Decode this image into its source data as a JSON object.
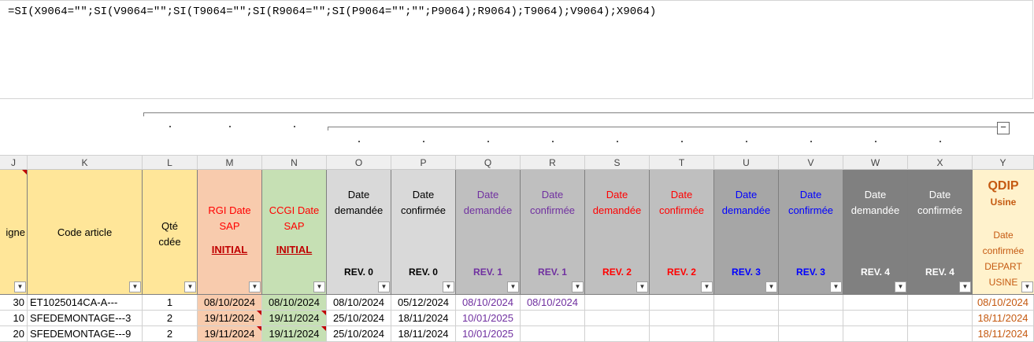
{
  "formula_bar": {
    "text": "=SI(X9064=\"\";SI(V9064=\"\";SI(T9064=\"\";SI(R9064=\"\";SI(P9064=\"\";\"\";P9064);R9064);T9064);V9064);X9064)"
  },
  "outline": {
    "collapse_symbol": "−"
  },
  "columns": [
    "J",
    "K",
    "L",
    "M",
    "N",
    "O",
    "P",
    "Q",
    "R",
    "S",
    "T",
    "U",
    "V",
    "W",
    "X",
    "Y"
  ],
  "headers": {
    "J": {
      "text": "igne"
    },
    "K": {
      "text": "Code article"
    },
    "L": {
      "line1": "Qté",
      "line2": "cdée"
    },
    "M": {
      "line1": "RGI Date",
      "line2": "SAP",
      "tag": "INITIAL"
    },
    "N": {
      "line1": "CCGI Date",
      "line2": "SAP",
      "tag": "INITIAL"
    },
    "O": {
      "line1": "Date",
      "line2": "demandée",
      "rev": "REV. 0"
    },
    "P": {
      "line1": "Date",
      "line2": "confirmée",
      "rev": "REV. 0"
    },
    "Q": {
      "line1": "Date",
      "line2": "demandée",
      "rev": "REV. 1"
    },
    "R": {
      "line1": "Date",
      "line2": "confirmée",
      "rev": "REV. 1"
    },
    "S": {
      "line1": "Date",
      "line2": "demandée",
      "rev": "REV. 2"
    },
    "T": {
      "line1": "Date",
      "line2": "confirmée",
      "rev": "REV. 2"
    },
    "U": {
      "line1": "Date",
      "line2": "demandée",
      "rev": "REV. 3"
    },
    "V": {
      "line1": "Date",
      "line2": "confirmée",
      "rev": "REV. 3"
    },
    "W": {
      "line1": "Date",
      "line2": "demandée",
      "rev": "REV. 4"
    },
    "X": {
      "line1": "Date",
      "line2": "confirmée",
      "rev": "REV. 4"
    },
    "Y": {
      "title": "QDIP",
      "subtitle": "Usine",
      "l1": "Date",
      "l2": "confirmée",
      "l3": "DEPART",
      "l4": "USINE"
    }
  },
  "filter_icon": "filter-dropdown-icon",
  "colors": {
    "yellow": "#ffe699",
    "orange": "#f8cbad",
    "green": "#c6e0b4",
    "grey1": "#d9d9d9",
    "grey2": "#bfbfbf",
    "grey3": "#a6a6a6",
    "grey4": "#808080",
    "purple": "#7030a0",
    "red": "#ff0000",
    "blue": "#0000ff",
    "qdip": "#c55a11",
    "darkred": "#c00000"
  },
  "rows": [
    {
      "J": "30",
      "K": "ET1025014CA-A---",
      "L": "1",
      "M": "08/10/2024",
      "N": "08/10/2024",
      "O": "08/10/2024",
      "P": "05/12/2024",
      "Q": "08/10/2024",
      "R": "08/10/2024",
      "Y": "08/10/2024"
    },
    {
      "J": "10",
      "K": "SFEDEMONTAGE---3",
      "L": "2",
      "M": "19/11/2024",
      "N": "19/11/2024",
      "O": "25/10/2024",
      "P": "18/11/2024",
      "Q": "10/01/2025",
      "R": "",
      "Y": "18/11/2024"
    },
    {
      "J": "20",
      "K": "SFEDEMONTAGE---9",
      "L": "2",
      "M": "19/11/2024",
      "N": "19/11/2024",
      "O": "25/10/2024",
      "P": "18/11/2024",
      "Q": "10/01/2025",
      "R": "",
      "Y": "18/11/2024"
    }
  ]
}
